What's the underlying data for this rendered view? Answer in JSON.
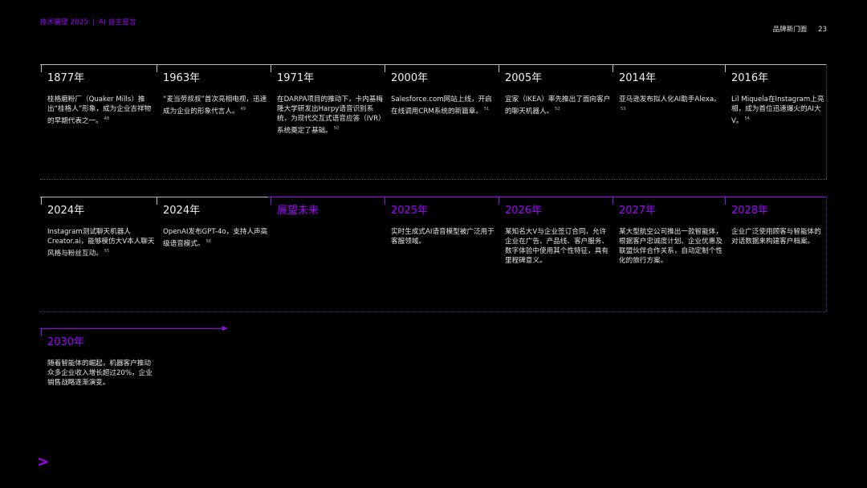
{
  "header": {
    "report": "技术展望 2025",
    "separator": "|",
    "section": "AI 自主宣言",
    "chapter": "品牌新门面",
    "page": "23"
  },
  "row1": [
    {
      "year": "1877年",
      "text": "桂格磨粉厂（Quaker Mills）推出“桂格人”形象，成为企业吉祥物的早期代表之一。",
      "ref": "48"
    },
    {
      "year": "1963年",
      "text": "“麦当劳叔叔”首次亮相电视，迅速成为企业的形象代言人。",
      "ref": "49"
    },
    {
      "year": "1971年",
      "text": "在DARPA项目的推动下，卡内基梅隆大学研发出Harpy语音识别系统，为现代交互式语音应答（IVR）系统奠定了基础。",
      "ref": "50"
    },
    {
      "year": "2000年",
      "text": "Salesforce.com网站上线，开启在线调用CRM系统的新篇章。",
      "ref": "51"
    },
    {
      "year": "2005年",
      "text": "宜家（IKEA）率先推出了面向客户的聊天机器人。",
      "ref": "52"
    },
    {
      "year": "2014年",
      "text": "亚马逊发布拟人化AI助手Alexa。",
      "ref": "53"
    },
    {
      "year": "2016年",
      "text": "Lil Miquela在Instagram上亮相，成为首位迅速爆火的AI大V。",
      "ref": "54"
    }
  ],
  "row2": [
    {
      "year": "2024年",
      "text": "Instagram测试聊天机器人Creator.ai，能够模仿大V本人聊天风格与粉丝互动。",
      "ref": "55"
    },
    {
      "year": "2024年",
      "text": "OpenAI发布GPT-4o，支持人声高级语音模式。",
      "ref": "56"
    },
    {
      "year": "展望未来",
      "text": "",
      "ref": ""
    },
    {
      "year": "2025年",
      "text": "实时生成式AI语音模型被广泛用于客服领域。",
      "ref": ""
    },
    {
      "year": "2026年",
      "text": "某知名大V与企业签订合同，允许企业在广告、产品线、客户服务、数字体验中使用其个性特征，具有里程碑意义。",
      "ref": ""
    },
    {
      "year": "2027年",
      "text": "某大型航空公司推出一款智能体，根据客户忠诚度计划、企业优惠及联盟伙伴合作关系，自动定制个性化的旅行方案。",
      "ref": ""
    },
    {
      "year": "2028年",
      "text": "企业广泛使用顾客与智能体的对话数据来构建客户档案。",
      "ref": ""
    }
  ],
  "row3": [
    {
      "year": "2030年",
      "text": "随着智能体的崛起，机器客户推动众多企业收入增长超过20%，企业销售战略逐渐演变。",
      "ref": ""
    }
  ],
  "logo": ">",
  "colors": {
    "accent": "#a100ff",
    "background": "#000000",
    "text": "#e6e6e6",
    "line": "#bdbdbd"
  }
}
